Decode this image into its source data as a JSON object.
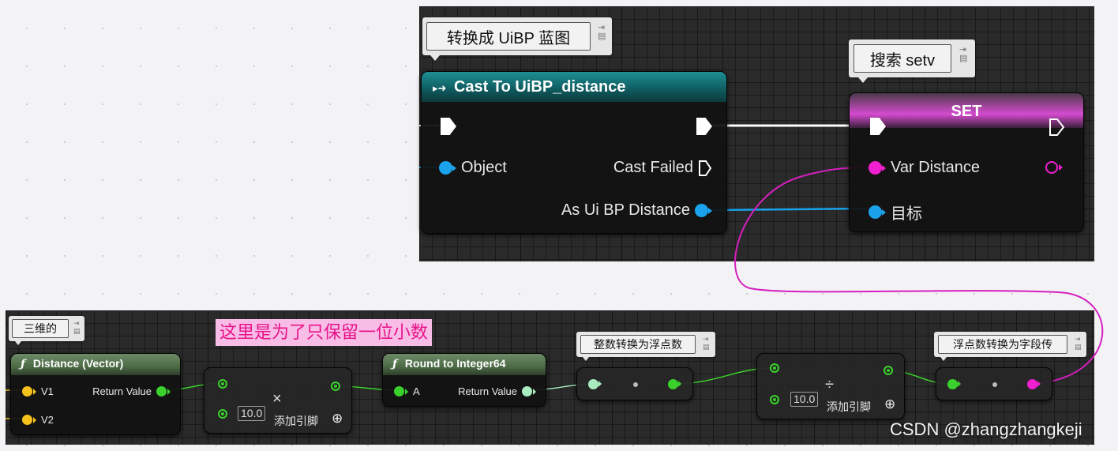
{
  "colors": {
    "exec": "#ffffff",
    "object_pin": "#1aa3ec",
    "float_pin": "#3bd12d",
    "integer64_pin": "#a9ecc0",
    "vector_pin": "#f5c21c",
    "string_pin": "#f01fcf",
    "cast_header": "#0f5e62",
    "set_header": "#d54bd0",
    "function_header": "#4c6b45",
    "annotation_text": "#e8138a",
    "annotation_bg": "#f8bde6"
  },
  "top": {
    "comment_cast": {
      "text": "转换成 UiBP 蓝图",
      "pin_icon": "pin-icon"
    },
    "comment_set": {
      "text": "搜索 setv",
      "pin_icon": "pin-icon"
    },
    "cast_node": {
      "icon": "cast-arrow-icon",
      "title": "Cast To UiBP_distance",
      "object_label": "Object",
      "cast_failed_label": "Cast Failed",
      "as_label": "As Ui BP Distance"
    },
    "set_node": {
      "title": "SET",
      "var_label": "Var Distance",
      "target_label": "目标"
    }
  },
  "bottom": {
    "comment_distance": {
      "text": "三维的"
    },
    "annotation": {
      "text": "这里是为了只保留一位小数"
    },
    "distance_node": {
      "icon": "function-icon",
      "title": "Distance (Vector)",
      "v1_label": "V1",
      "v2_label": "V2",
      "return_label": "Return Value"
    },
    "multiply_node": {
      "symbol": "×",
      "value": "10.0",
      "add_pin_label": "添加引脚",
      "add_icon": "plus-circle-icon"
    },
    "round_node": {
      "icon": "function-icon",
      "title": "Round to Integer64",
      "a_label": "A",
      "return_label": "Return Value"
    },
    "comment_int_to_float": {
      "text": "整数转换为浮点数"
    },
    "divide_node": {
      "symbol": "÷",
      "value": "10.0",
      "add_pin_label": "添加引脚",
      "add_icon": "plus-circle-icon"
    },
    "comment_float_to_string": {
      "text": "浮点数转换为字段传"
    }
  },
  "watermark": "CSDN @zhangzhangkeji"
}
